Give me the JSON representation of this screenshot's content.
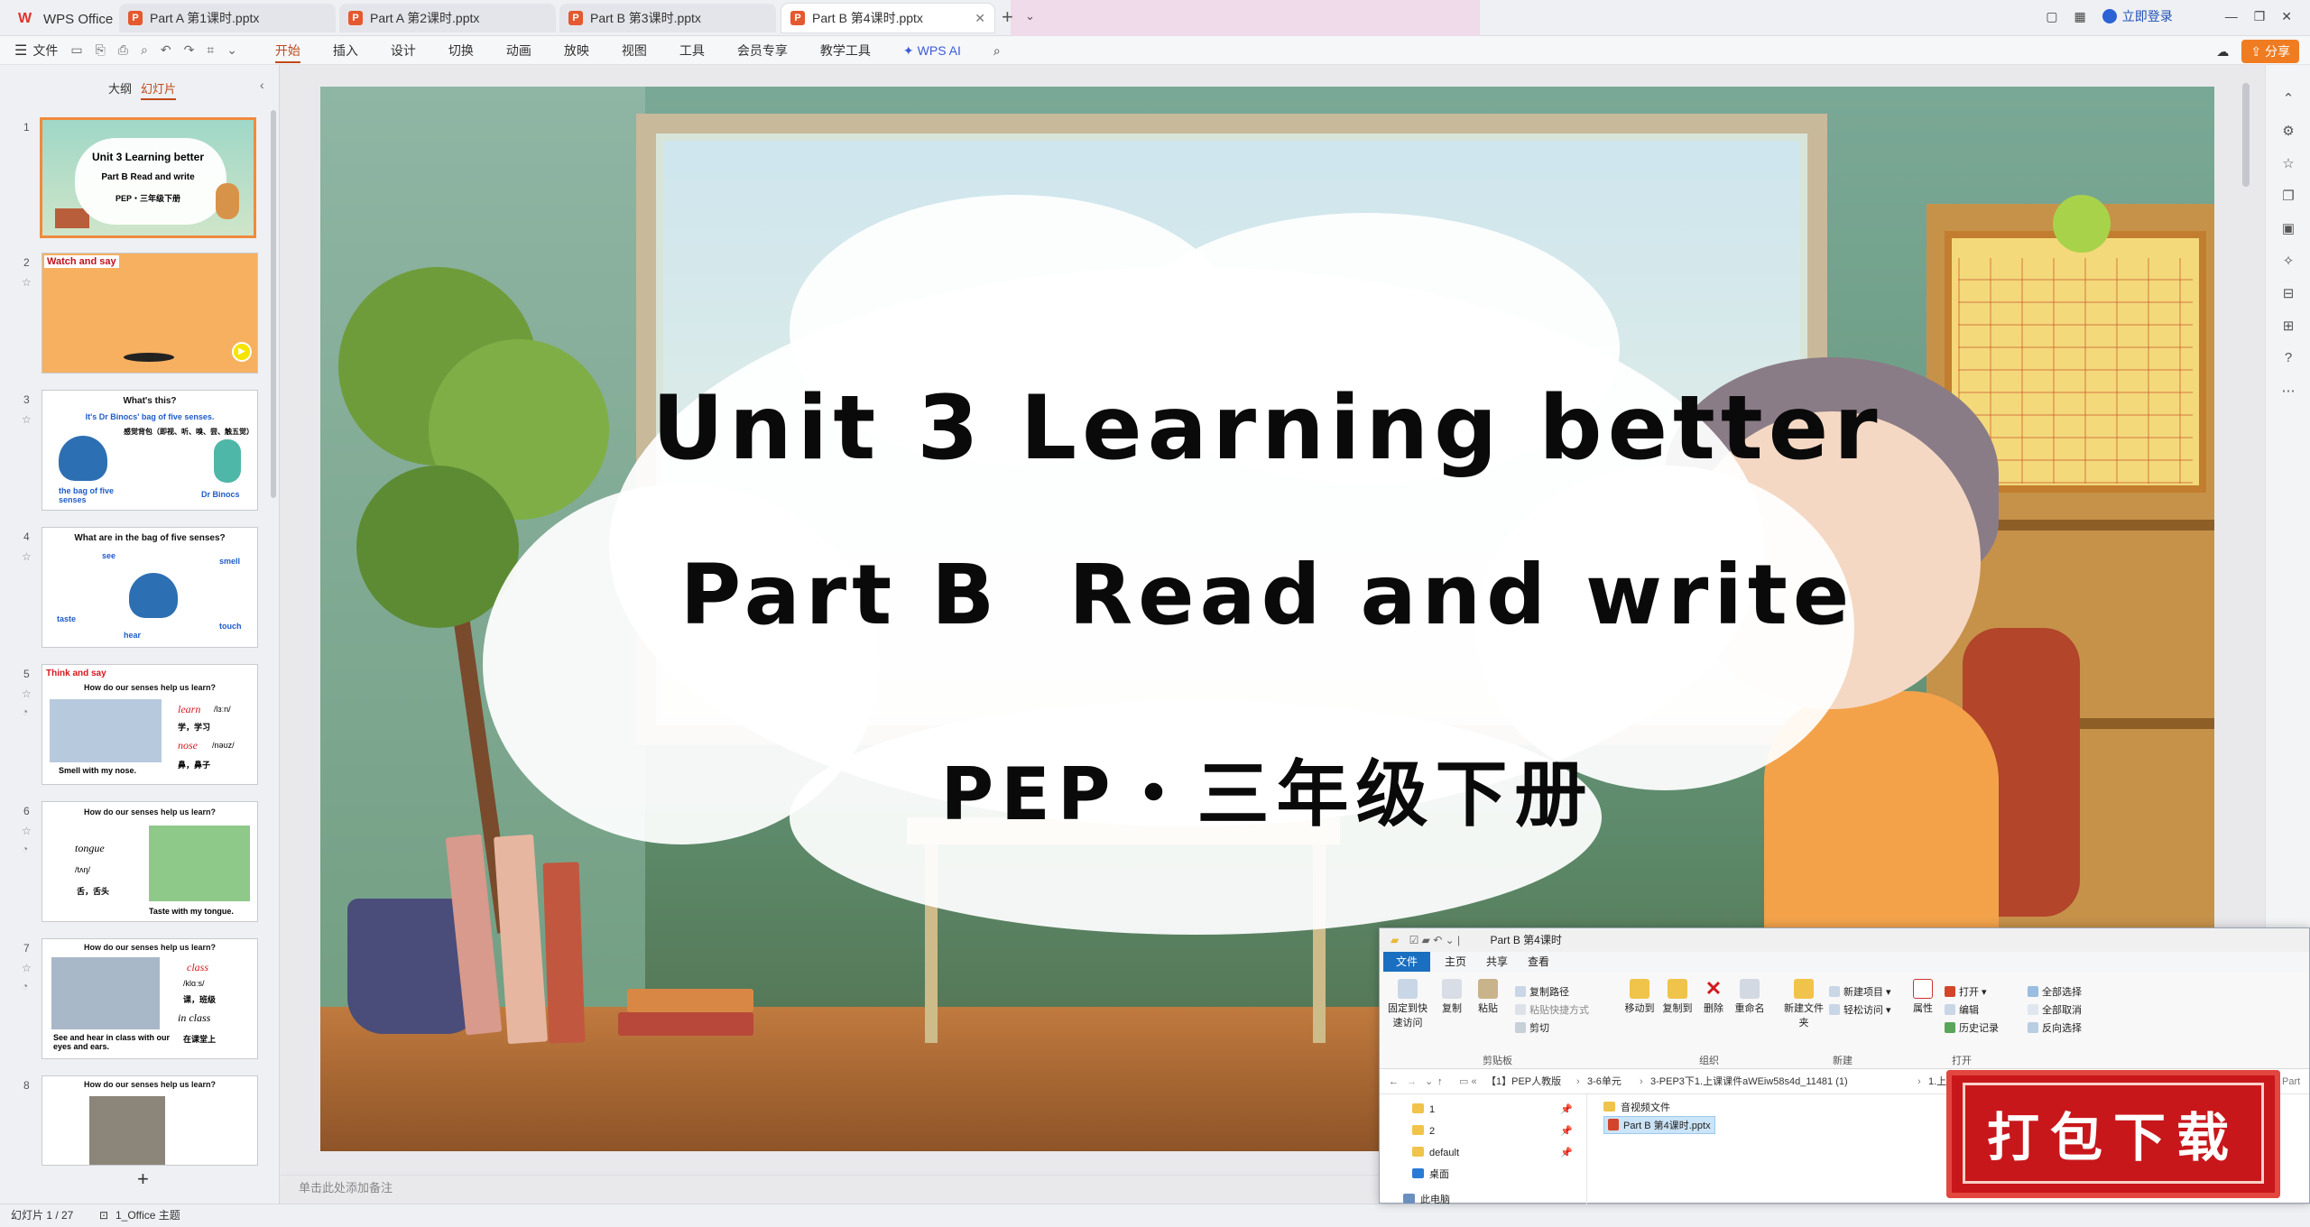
{
  "app": {
    "name": "WPS Office"
  },
  "tabs": [
    {
      "label": "Part  A 第1课时.pptx",
      "active": false
    },
    {
      "label": "Part  A 第2课时.pptx",
      "active": false
    },
    {
      "label": "Part  B 第3课时.pptx",
      "active": false
    },
    {
      "label": "Part  B 第4课时.pptx",
      "active": true
    }
  ],
  "titlebar": {
    "login": "立即登录"
  },
  "ribbon": {
    "file": "文件",
    "tabs": [
      "开始",
      "插入",
      "设计",
      "切换",
      "动画",
      "放映",
      "视图",
      "工具",
      "会员专享",
      "教学工具"
    ],
    "active_tab": "开始",
    "ai": "WPS AI",
    "share": "分享"
  },
  "left_panel": {
    "tab_outline": "大纲",
    "tab_slides": "幻灯片",
    "add_slide": "+"
  },
  "thumbnails": {
    "s1": {
      "num": "1",
      "line1": "Unit 3 Learning better",
      "line2": "Part B  Read and write",
      "line3": "PEP・三年级下册"
    },
    "s2": {
      "num": "2",
      "header": "Watch and say"
    },
    "s3": {
      "num": "3",
      "title": "What's this?",
      "sub": "It's Dr Binocs' bag of five senses.",
      "cn": "感觉背包（即视、听、嗅、尝、触五觉）",
      "left": "the bag of five senses",
      "right": "Dr Binocs"
    },
    "s4": {
      "num": "4",
      "title": "What are in the bag of five senses?",
      "w1": "see",
      "w2": "smell",
      "w3": "taste",
      "w4": "hear",
      "w5": "touch"
    },
    "s5": {
      "num": "5",
      "header": "Think and say",
      "q": "How do our senses help us learn?",
      "w1": "learn",
      "p1": "/lɜːn/",
      "c1": "学，学习",
      "w2": "nose",
      "p2": "/nəʊz/",
      "c2": "鼻，鼻子",
      "cap": "Smell with my nose."
    },
    "s6": {
      "num": "6",
      "q": "How do our senses help us learn?",
      "w1": "tongue",
      "p1": "/tʌŋ/",
      "c1": "舌，舌头",
      "cap": "Taste with my tongue."
    },
    "s7": {
      "num": "7",
      "q": "How do our senses help us learn?",
      "w1": "class",
      "p1": "/klɑːs/",
      "c1": "课，班级",
      "w2": "in class",
      "c2": "在课堂上",
      "cap": "See and hear in class with our eyes and ears."
    },
    "s8": {
      "num": "8",
      "q": "How do our senses help us learn?"
    }
  },
  "slide": {
    "title": "Unit 3 Learning better",
    "subtitle": "Part B  Read and write",
    "book": "PEP・三年级下册"
  },
  "notes_placeholder": "单击此处添加备注",
  "status": {
    "slide_counter": "幻灯片 1 / 27",
    "theme": "1_Office 主题"
  },
  "explorer": {
    "title": "Part  B 第4课时",
    "tabs": [
      "文件",
      "主页",
      "共享",
      "查看"
    ],
    "buttons": {
      "pin": "固定到快速访问",
      "copy": "复制",
      "paste": "粘贴",
      "copy_path": "复制路径",
      "paste_shortcut": "粘贴快捷方式",
      "cut": "剪切",
      "move_to": "移动到",
      "copy_to": "复制到",
      "delete": "删除",
      "rename": "重命名",
      "new_folder": "新建文件夹",
      "new_item": "新建项目",
      "easy_access": "轻松访问",
      "properties": "属性",
      "open": "打开",
      "edit": "编辑",
      "history": "历史记录",
      "select_all": "全部选择",
      "select_none": "全部取消",
      "invert": "反向选择"
    },
    "groups": {
      "clipboard": "剪贴板",
      "organize": "组织",
      "new": "新建",
      "open": "打开"
    },
    "address": [
      "【1】PEP人教版",
      "3-6单元",
      "3-PEP3下1.上课课件aWEiw58s4d_11481 (1)",
      "1.上课"
    ],
    "address_tail": "Part",
    "nav": [
      "1",
      "2",
      "default",
      "桌面",
      "此电脑"
    ],
    "files": [
      {
        "name": "音视频文件",
        "type": "folder"
      },
      {
        "name": "Part  B 第4课时.pptx",
        "type": "pptx"
      }
    ]
  },
  "stamp": {
    "text": "打包下载"
  }
}
